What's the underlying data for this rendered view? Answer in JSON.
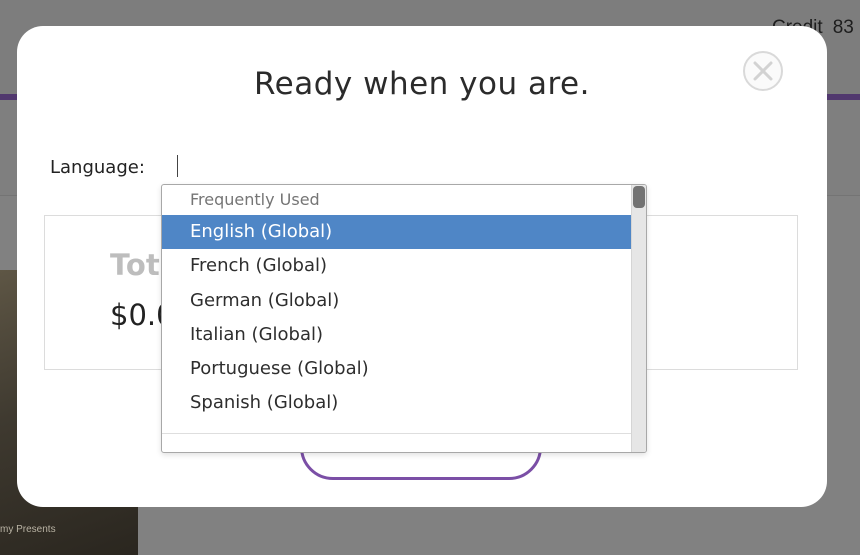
{
  "background": {
    "credit_label": "Credit",
    "credit_value": "83",
    "image_caption": "my Presents"
  },
  "modal": {
    "title": "Ready when you are.",
    "close_icon": "close-icon",
    "language_label": "Language:",
    "language_value": "",
    "total_label": "Tota",
    "total_value": "$0.0"
  },
  "dropdown": {
    "group_label": "Frequently Used",
    "options": [
      {
        "label": "English (Global)",
        "selected": true
      },
      {
        "label": "French (Global)",
        "selected": false
      },
      {
        "label": "German (Global)",
        "selected": false
      },
      {
        "label": "Italian (Global)",
        "selected": false
      },
      {
        "label": "Portuguese (Global)",
        "selected": false
      },
      {
        "label": "Spanish (Global)",
        "selected": false
      }
    ]
  },
  "colors": {
    "accent_purple": "#7b4fa6",
    "selected_blue": "#4f86c6",
    "overlay_gray": "#818181"
  }
}
